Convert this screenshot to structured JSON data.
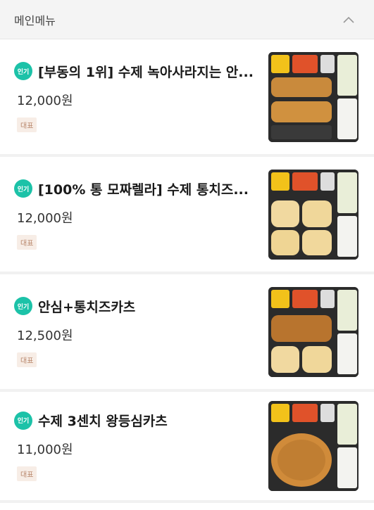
{
  "section": {
    "title": "메인메뉴",
    "collapse_icon": "chevron-up-icon"
  },
  "items": [
    {
      "badge": "인기",
      "name": "[부동의 1위] 수제 녹아사라지는 안...",
      "price": "12,000원",
      "tag": "대표",
      "image": "cutlet-bento-two-strips"
    },
    {
      "badge": "인기",
      "name": "[100% 통 모짜렐라]  수제 통치즈...",
      "price": "12,000원",
      "tag": "대표",
      "image": "cheese-cutlet-bento"
    },
    {
      "badge": "인기",
      "name": "안심+통치즈카츠",
      "price": "12,500원",
      "tag": "대표",
      "image": "tenderloin-cheese-bento"
    },
    {
      "badge": "인기",
      "name": "수제 3센치 왕등심카츠",
      "price": "11,000원",
      "tag": "대표",
      "image": "loin-cutlet-bento"
    }
  ],
  "colors": {
    "badge": "#1cc2a8",
    "tag_bg": "#f7ede6",
    "tag_text": "#b8876b",
    "header_bg": "#f4f4f4"
  }
}
